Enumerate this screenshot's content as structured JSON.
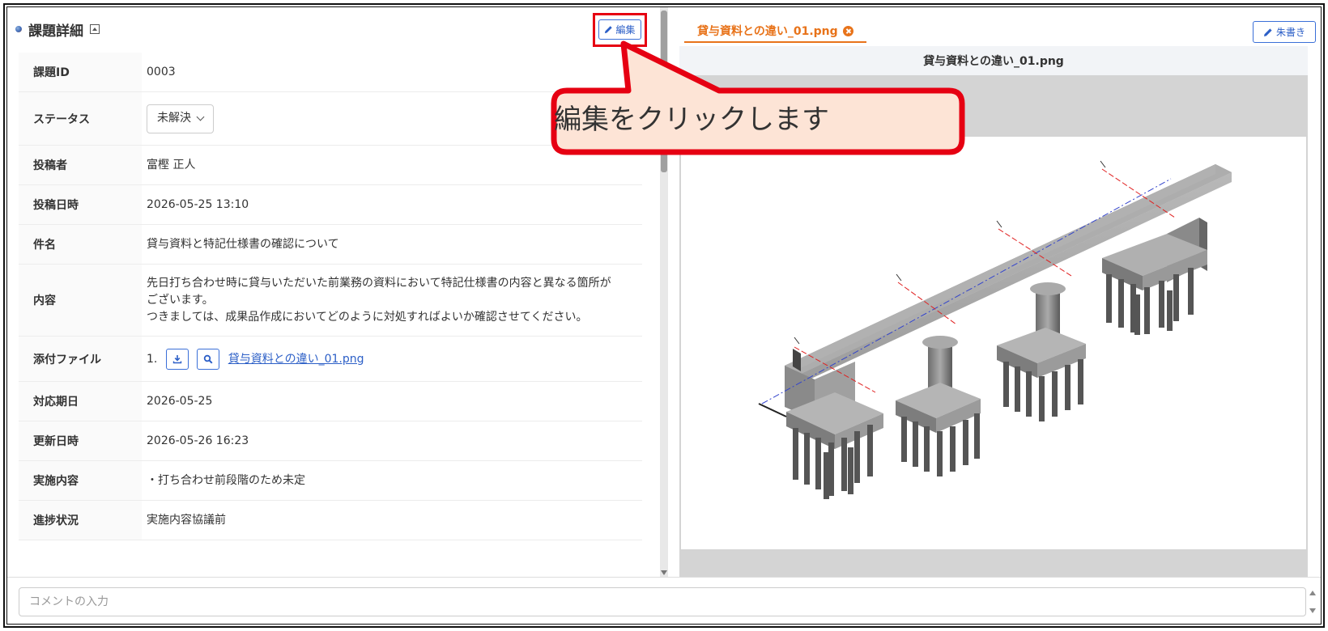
{
  "detail": {
    "title": "課題詳細",
    "edit_label": "編集",
    "rows": [
      {
        "label": "課題ID",
        "value": "0003"
      },
      {
        "label": "ステータス",
        "value": "未解決"
      },
      {
        "label": "投稿者",
        "value": "富樫 正人"
      },
      {
        "label": "投稿日時",
        "value": "2026-05-25 13:10"
      },
      {
        "label": "件名",
        "value": "貸与資料と特記仕様書の確認について"
      },
      {
        "label": "内容",
        "value_line1": "先日打ち合わせ時に貸与いただいた前業務の資料において特記仕様書の内容と異なる箇所が",
        "value_line2": "ございます。",
        "value_line3": "つきましては、成果品作成においてどのように対処すればよいか確認させてください。"
      },
      {
        "label": "添付ファイル",
        "index": "1.",
        "file": "貸与資料との違い_01.png"
      },
      {
        "label": "対応期日",
        "value": "2026-05-25"
      },
      {
        "label": "更新日時",
        "value": "2026-05-26 16:23"
      },
      {
        "label": "実施内容",
        "value": "・打ち合わせ前段階のため未定"
      },
      {
        "label": "進捗状況",
        "value": "実施内容協議前"
      }
    ]
  },
  "viewer": {
    "tab_label": "貸与資料との違い_01.png",
    "redpen_label": "朱書き",
    "image_title": "貸与資料との違い_01.png"
  },
  "comment": {
    "placeholder": "コメントの入力"
  },
  "callout": {
    "text": "編集をクリックします"
  },
  "colors": {
    "accent_blue": "#2c5fc7",
    "tab_orange": "#e8731a",
    "highlight_red": "#e60012",
    "callout_fill": "#fde4d6"
  }
}
